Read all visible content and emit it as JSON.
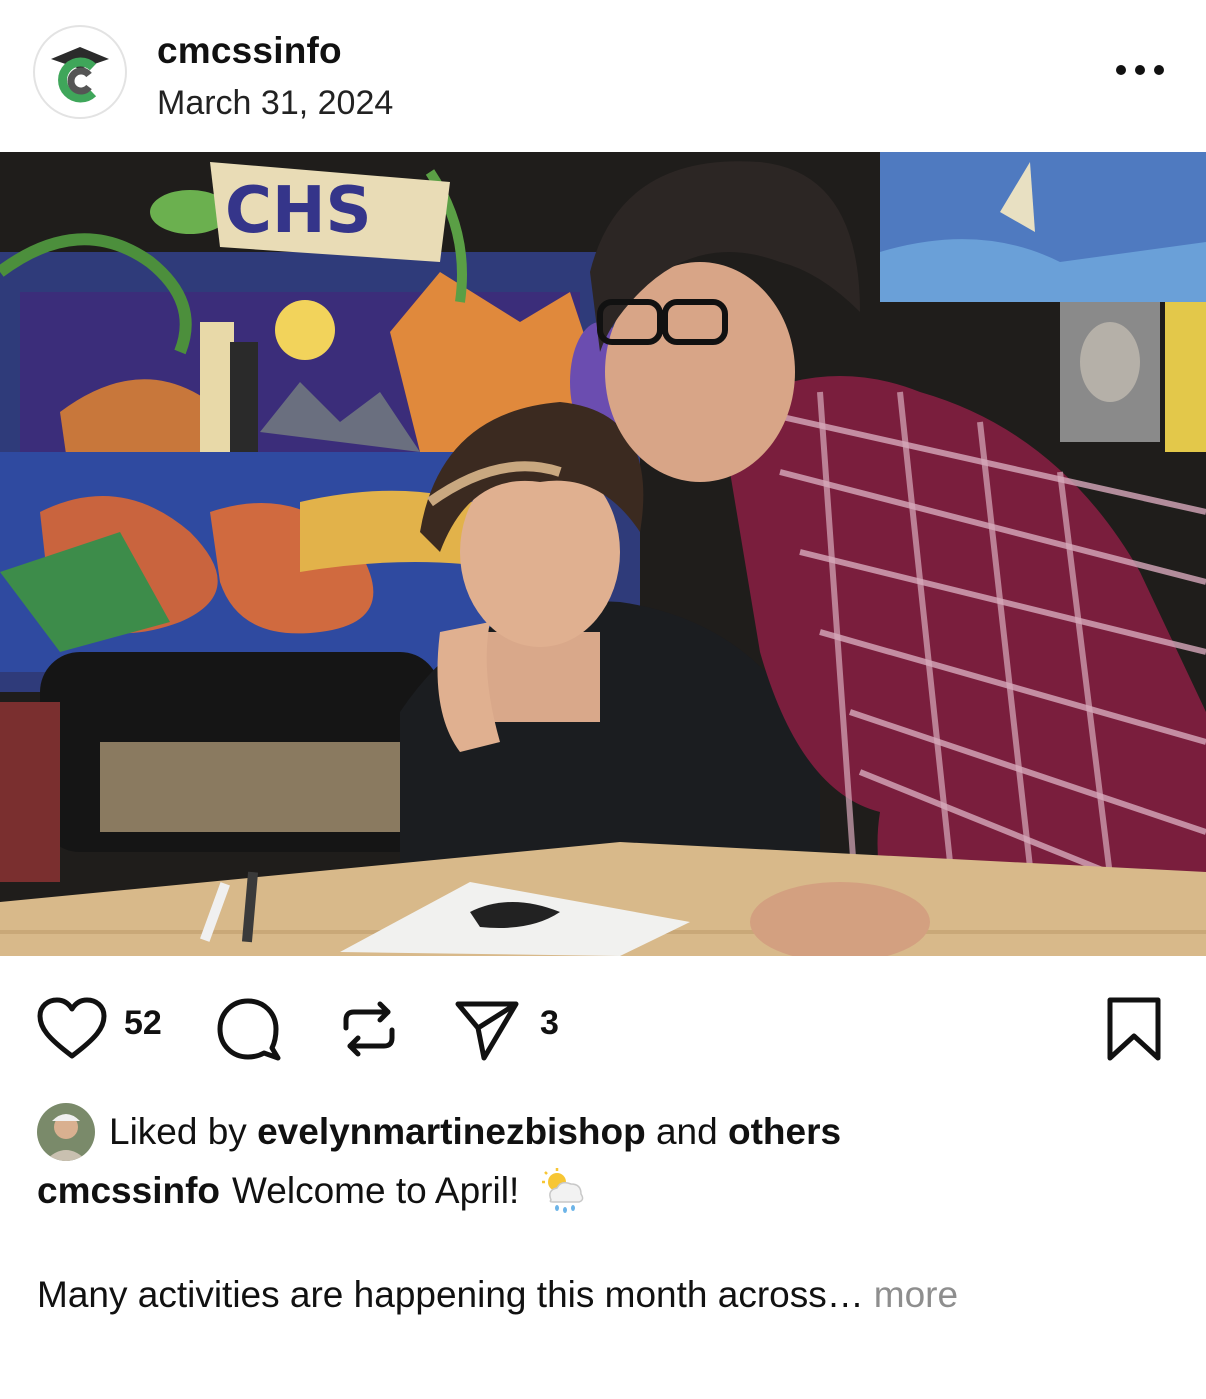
{
  "post": {
    "username": "cmcssinfo",
    "date": "March 31, 2024",
    "avatar_icon": "graduation-cap-c-logo-icon",
    "photo_mural_text": "CHS"
  },
  "actions": {
    "like_count": "52",
    "share_count": "3",
    "icons": [
      "heart-icon",
      "comment-icon",
      "repost-icon",
      "send-icon",
      "bookmark-icon"
    ]
  },
  "likes": {
    "prefix": "Liked by",
    "user": "evelynmartinezbishop",
    "joiner": "and",
    "others": "others"
  },
  "caption": {
    "username": "cmcssinfo",
    "text": "Welcome to April!",
    "emoji": "sun-behind-rain-cloud-icon",
    "body": "Many activities are happening this month across…",
    "more": "more"
  },
  "colors": {
    "text": "#111111",
    "muted": "#8e8e8e",
    "logo_green": "#3fa65a",
    "logo_dark": "#333333"
  }
}
